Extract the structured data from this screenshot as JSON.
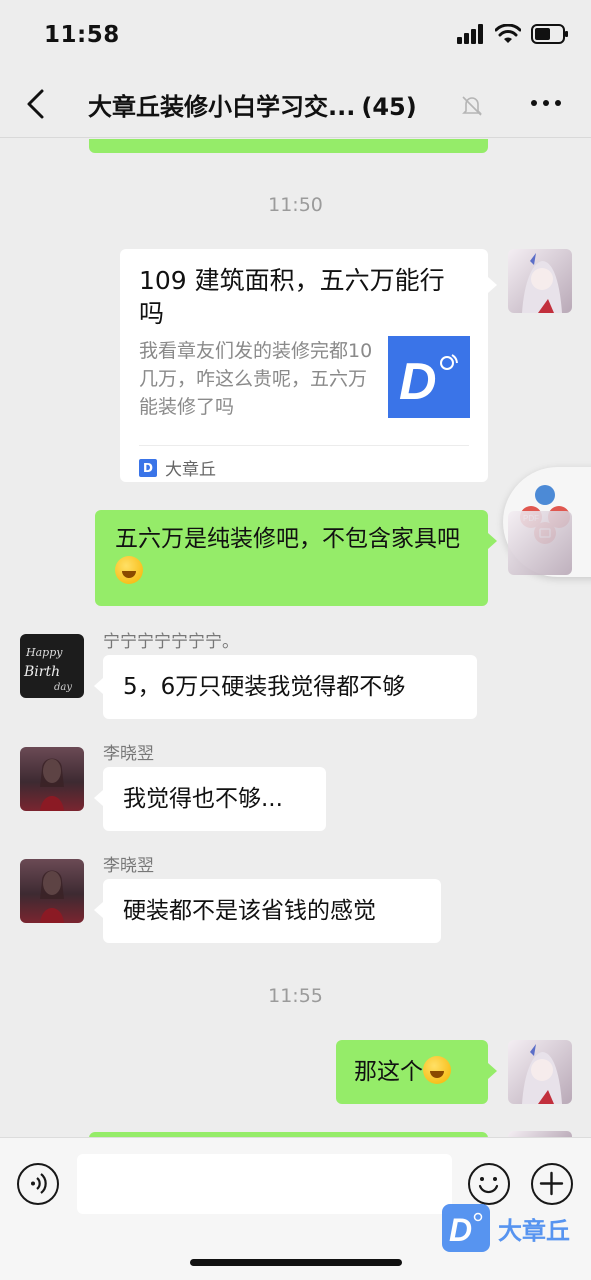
{
  "status_bar": {
    "time": "11:58"
  },
  "header": {
    "title": "大章丘装修小白学习交...",
    "member_count": "(45)"
  },
  "messages": {
    "time_1": "11:50",
    "link_card": {
      "title": "109 建筑面积，五六万能行吗",
      "description": "我看章友们发的装修完都10几万，咋这么贵呢，五六万能装修了吗",
      "source": "大章丘",
      "thumb_letter": "D"
    },
    "me_1": "五六万是纯装修吧，不包含家具吧",
    "sender_1": "宁宁宁宁宁宁宁。",
    "msg_1": "5，6万只硬装我觉得都不够",
    "sender_2": "李晓翌",
    "msg_2": "我觉得也不够...",
    "sender_3": "李晓翌",
    "msg_3": "硬装都不是该省钱的感觉",
    "time_2": "11:55",
    "me_2": "那这个",
    "birthday_avatar_text": "Happy Birthday"
  },
  "input": {
    "placeholder": ""
  },
  "watermark": {
    "brand": "大章丘",
    "letter": "D"
  },
  "colors": {
    "bg": "#ededed",
    "my_bubble": "#95ec69",
    "other_bubble": "#ffffff",
    "brand_blue": "#3a74e8"
  },
  "icons": [
    "back-arrow-icon",
    "mute-bell-icon",
    "more-icon",
    "voice-icon",
    "emoji-icon",
    "plus-icon",
    "signal-icon",
    "wifi-icon",
    "battery-icon"
  ]
}
